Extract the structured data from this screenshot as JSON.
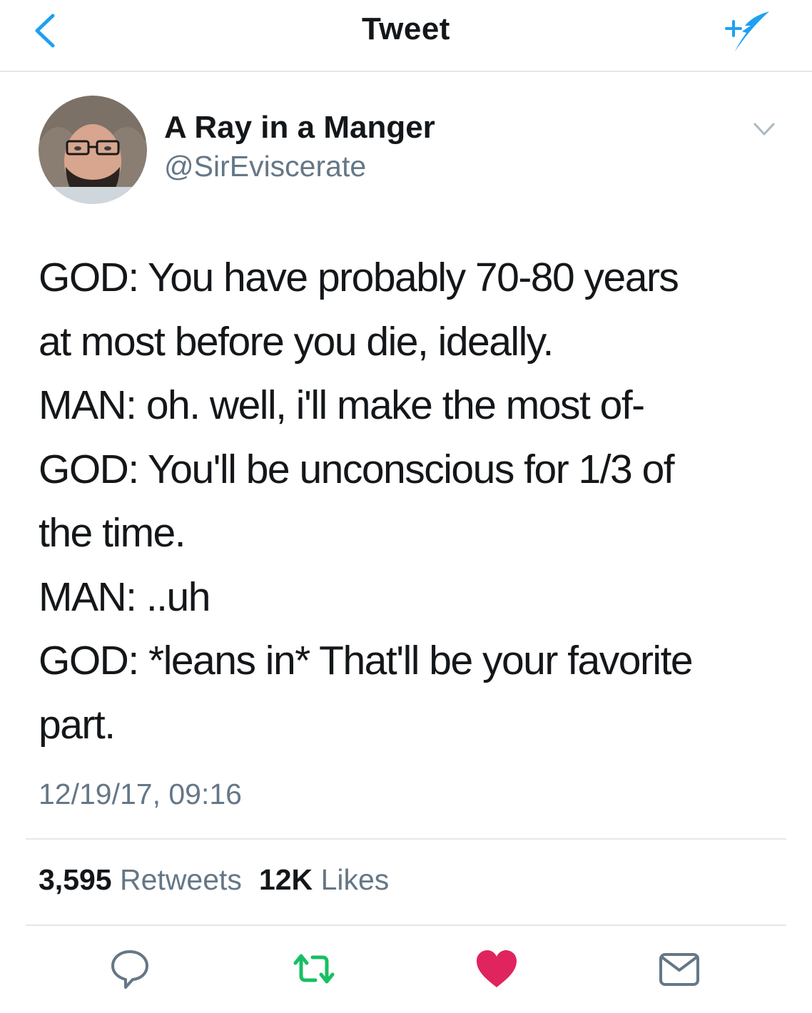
{
  "navbar": {
    "title": "Tweet"
  },
  "author": {
    "display_name": "A Ray in a Manger",
    "handle": "@SirEviscerate"
  },
  "tweet": {
    "lines": [
      "GOD: You have probably 70-80 years",
      "at most before you die, ideally.",
      "MAN: oh. well, i'll make the most of-",
      "GOD: You'll be unconscious for 1/3 of",
      "the time.",
      "MAN: ..uh",
      "GOD: *leans in* That'll be your favorite",
      "part."
    ],
    "timestamp": "12/19/17, 09:16"
  },
  "stats": {
    "retweets_count": "3,595",
    "retweets_label": "Retweets",
    "likes_count": "12K",
    "likes_label": "Likes"
  },
  "icons": {
    "back": "chevron-left-icon",
    "compose": "compose-quill-icon",
    "more": "chevron-down-icon",
    "reply": "reply-bubble-icon",
    "retweet": "retweet-icon",
    "like": "heart-icon",
    "dm": "envelope-icon"
  },
  "colors": {
    "accent": "#1da1f2",
    "retweet_active": "#17bf63",
    "like_active": "#e0245e",
    "muted": "#657786",
    "text": "#14171a"
  },
  "state": {
    "liked": true,
    "retweeted": true
  }
}
